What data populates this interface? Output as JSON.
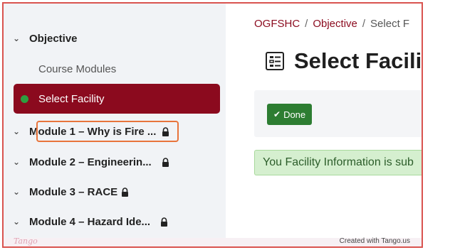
{
  "sidebar": {
    "items": [
      {
        "label": "Objective",
        "type": "expandable"
      },
      {
        "label": "Course Modules",
        "type": "link"
      },
      {
        "label": "Select Facility",
        "type": "active"
      },
      {
        "label": "Module 1 – Why is Fire ...",
        "type": "locked"
      },
      {
        "label": "Module 2 – Engineerin...",
        "type": "locked"
      },
      {
        "label": "Module 3 – RACE",
        "type": "locked"
      },
      {
        "label": "Module 4 – Hazard Ide...",
        "type": "locked"
      }
    ]
  },
  "breadcrumb": {
    "root": "OGFSHC",
    "section": "Objective",
    "current": "Select F"
  },
  "page": {
    "title": "Select Facili",
    "done_label": "Done",
    "alert_text": "You Facility Information is sub"
  },
  "footer": {
    "brand": "Tango",
    "credit": "Created with Tango.us"
  },
  "colors": {
    "active_bg": "#8b0a1e",
    "done_bg": "#2d7d32",
    "alert_bg": "#d5efcf",
    "highlight": "#e8743b",
    "frame": "#d9534f"
  }
}
